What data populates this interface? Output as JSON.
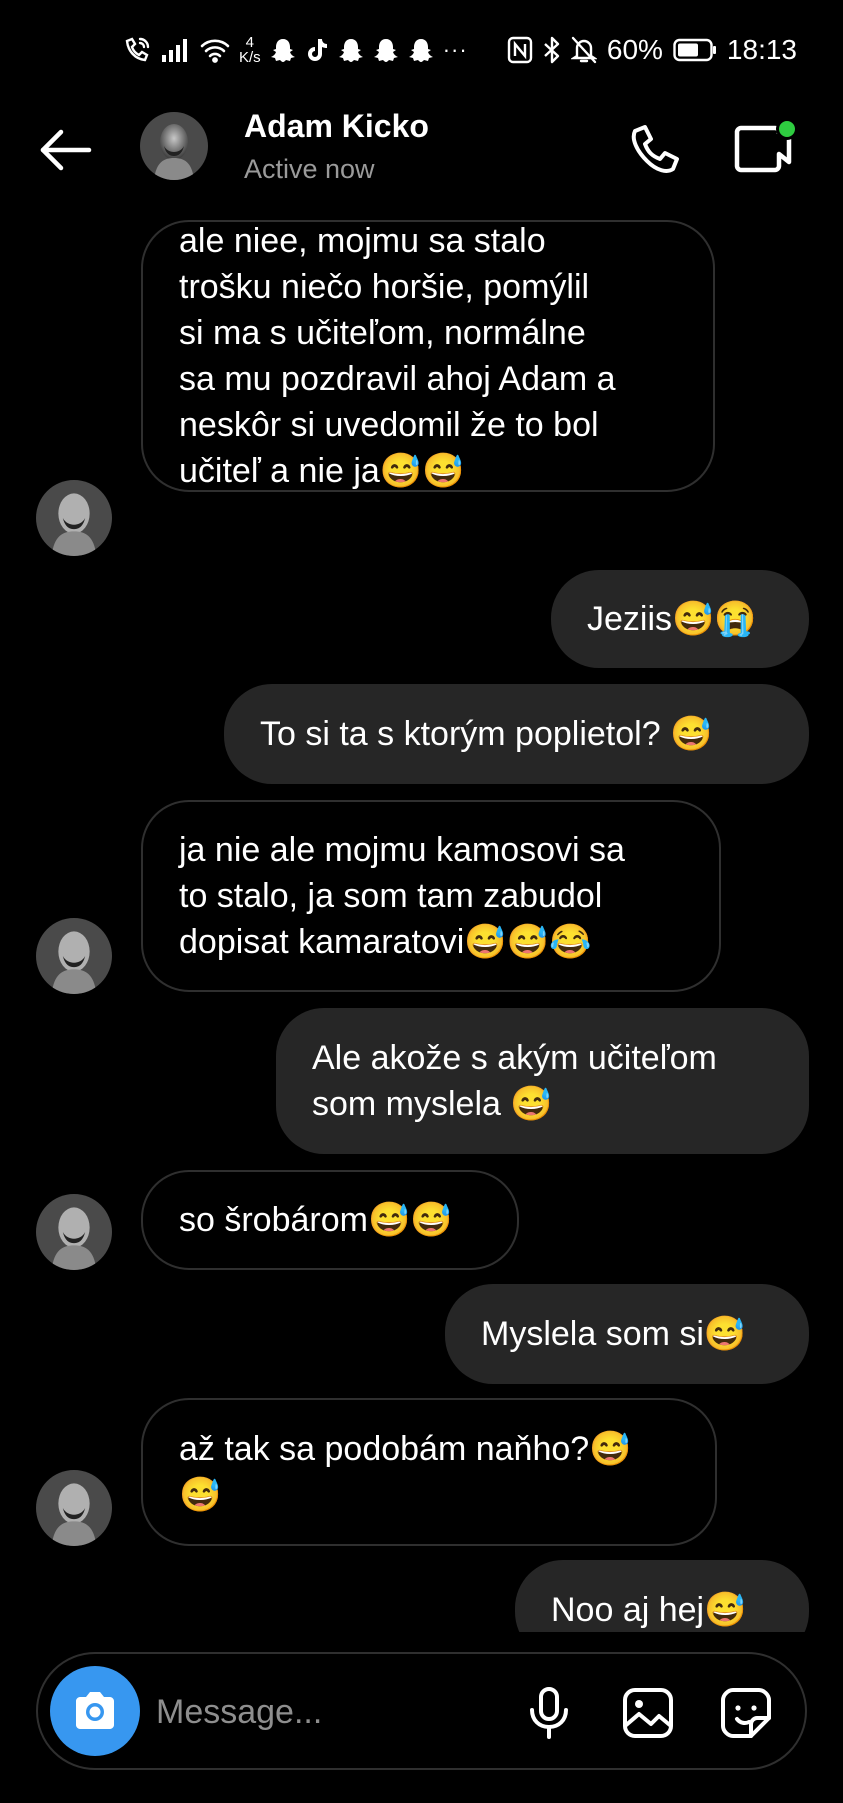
{
  "status_bar": {
    "netspeed_value": "4",
    "netspeed_unit": "K/s",
    "battery": "60%",
    "time": "18:13",
    "overflow": "···"
  },
  "header": {
    "back_icon": "arrow-left-icon",
    "name": "Adam Kicko",
    "status": "Active now",
    "call_icon": "phone-icon",
    "video_icon": "video-camera-icon",
    "online_color": "#2ecc40"
  },
  "messages": [
    {
      "direction": "incoming",
      "text": "ale niee, mojmu sa stalo\ntrošku niečo horšie, pomýlil\nsi ma s učiteľom, normálne\nsa mu pozdravil ahoj Adam a\nneskôr si uvedomil že to bol\nučiteľ a nie ja😅😅"
    },
    {
      "direction": "outgoing",
      "text": "Jeziis😅😭"
    },
    {
      "direction": "outgoing",
      "text": "To si ta s ktorým poplietol? 😅"
    },
    {
      "direction": "incoming",
      "text": "ja nie ale mojmu kamosovi sa\nto stalo, ja som tam zabudol\ndopisat kamaratovi😅😅😂"
    },
    {
      "direction": "outgoing",
      "text": "Ale akože s akým učiteľom\nsom myslela 😅"
    },
    {
      "direction": "incoming",
      "text": "so šrobárom😅😅"
    },
    {
      "direction": "outgoing",
      "text": "Myslela som si😅"
    },
    {
      "direction": "incoming",
      "text": "až tak sa podobám naňho?😅\n😅"
    },
    {
      "direction": "outgoing",
      "text": "Noo aj hej😅"
    }
  ],
  "composer": {
    "placeholder": "Message...",
    "camera_icon": "camera-icon",
    "mic_icon": "microphone-icon",
    "gallery_icon": "image-icon",
    "sticker_icon": "sticker-icon"
  },
  "colors": {
    "background": "#000000",
    "outgoing_bubble": "#262626",
    "incoming_border": "#2f2f2f",
    "accent": "#3797f0"
  }
}
